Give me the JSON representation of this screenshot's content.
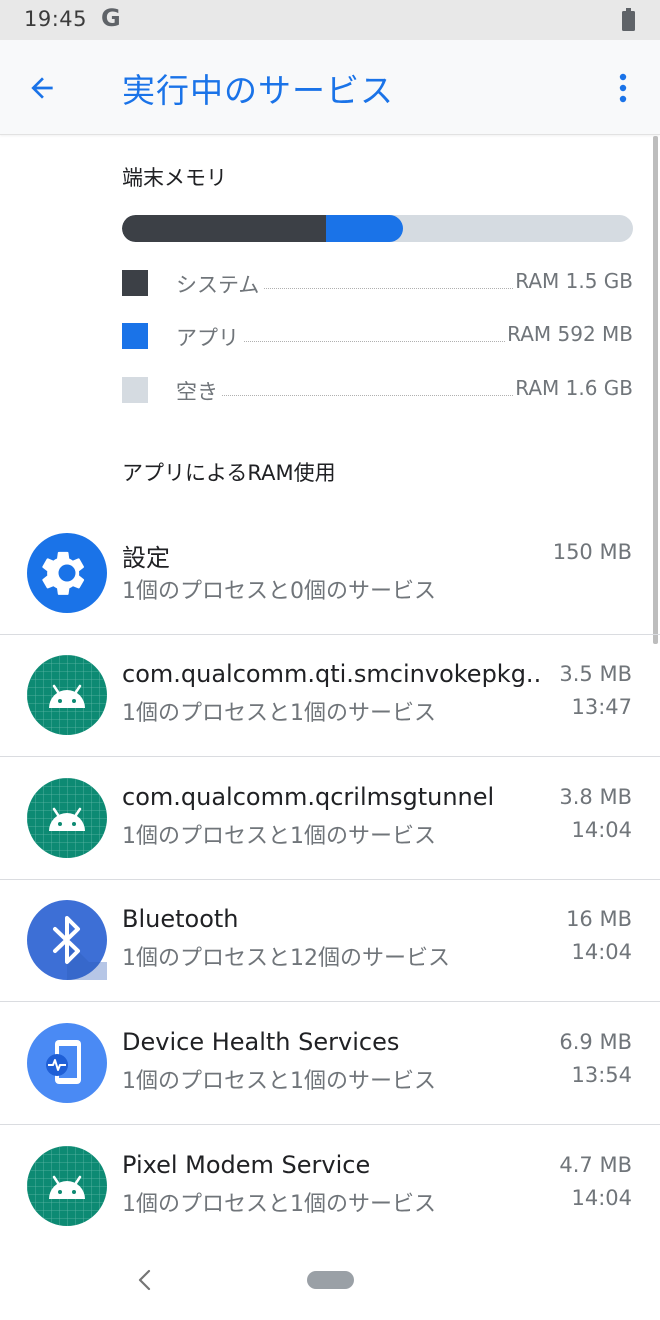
{
  "status_bar": {
    "time": "19:45",
    "g_letter": "G"
  },
  "app_bar": {
    "title": "実行中のサービス"
  },
  "memory": {
    "section_title": "端末メモリ",
    "usage_fraction": {
      "system": 0.4,
      "app": 0.15,
      "free": 0.45
    },
    "legend": [
      {
        "label": "システム",
        "value": "RAM 1.5 GB",
        "color": "#3c4046"
      },
      {
        "label": "アプリ",
        "value": "RAM 592 MB",
        "color": "#1a73e8"
      },
      {
        "label": "空き",
        "value": "RAM 1.6 GB",
        "color": "#d5dbe1"
      }
    ]
  },
  "apps_section_title": "アプリによるRAM使用",
  "apps": [
    {
      "name": "設定",
      "subtitle": "1個のプロセスと0個のサービス",
      "size": "150 MB",
      "time": "",
      "icon": "settings-gear-icon"
    },
    {
      "name": "com.qualcomm.qti.smcinvokepkg..",
      "subtitle": "1個のプロセスと1個のサービス",
      "size": "3.5 MB",
      "time": "13:47",
      "icon": "android-icon"
    },
    {
      "name": "com.qualcomm.qcrilmsgtunnel",
      "subtitle": "1個のプロセスと1個のサービス",
      "size": "3.8 MB",
      "time": "14:04",
      "icon": "android-icon"
    },
    {
      "name": "Bluetooth",
      "subtitle": "1個のプロセスと12個のサービス",
      "size": "16 MB",
      "time": "14:04",
      "icon": "bluetooth-icon"
    },
    {
      "name": "Device Health Services",
      "subtitle": "1個のプロセスと1個のサービス",
      "size": "6.9 MB",
      "time": "13:54",
      "icon": "device-health-icon"
    },
    {
      "name": "Pixel Modem Service",
      "subtitle": "1個のプロセスと1個のサービス",
      "size": "4.7 MB",
      "time": "14:04",
      "icon": "android-icon"
    }
  ]
}
